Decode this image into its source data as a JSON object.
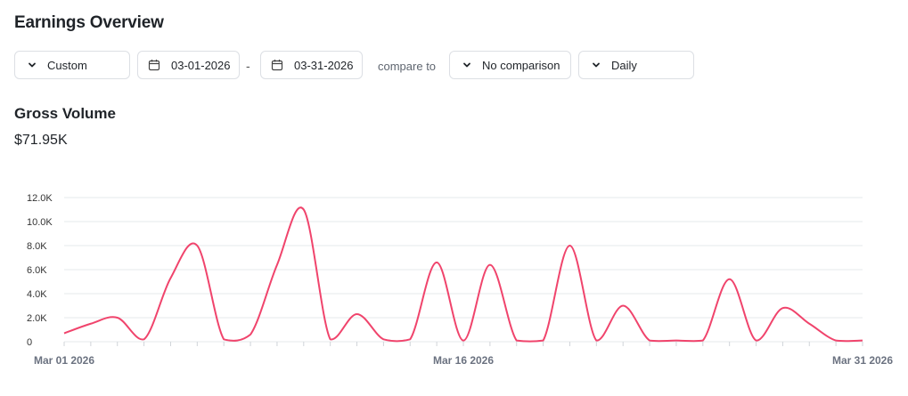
{
  "header": {
    "title": "Earnings Overview"
  },
  "filters": {
    "range_preset": "Custom",
    "start_date": "03-01-2026",
    "separator": "-",
    "end_date": "03-31-2026",
    "compare_label": "compare to",
    "comparison": "No comparison",
    "interval": "Daily"
  },
  "metric": {
    "title": "Gross Volume",
    "total": "$71.95K"
  },
  "colors": {
    "series": "#f0446c",
    "grid": "#e6e8eb"
  },
  "chart_data": {
    "type": "line",
    "title": "Gross Volume",
    "xlabel": "",
    "ylabel": "",
    "ylim": [
      0,
      12000
    ],
    "y_ticks": [
      "0",
      "2.0K",
      "4.0K",
      "6.0K",
      "8.0K",
      "10.0K",
      "12.0K"
    ],
    "y_tick_values": [
      0,
      2000,
      4000,
      6000,
      8000,
      10000,
      12000
    ],
    "x_tick_labels": [
      "Mar 01 2026",
      "Mar 16 2026",
      "Mar 31 2026"
    ],
    "grid": true,
    "series": [
      {
        "x": [
          1,
          2,
          3,
          4,
          5,
          6,
          7,
          8,
          9,
          10,
          11,
          12,
          13,
          14,
          15,
          16,
          17,
          18,
          19,
          20,
          21,
          22,
          23,
          24,
          25,
          26,
          27,
          28,
          29,
          30,
          31
        ],
        "values": [
          700,
          1500,
          2000,
          200,
          5300,
          8000,
          200,
          600,
          6400,
          11000,
          200,
          2300,
          200,
          200,
          6600,
          100,
          6400,
          100,
          100,
          8000,
          100,
          3000,
          100,
          100,
          100,
          5200,
          100,
          2800,
          1500,
          100,
          100
        ]
      }
    ]
  }
}
